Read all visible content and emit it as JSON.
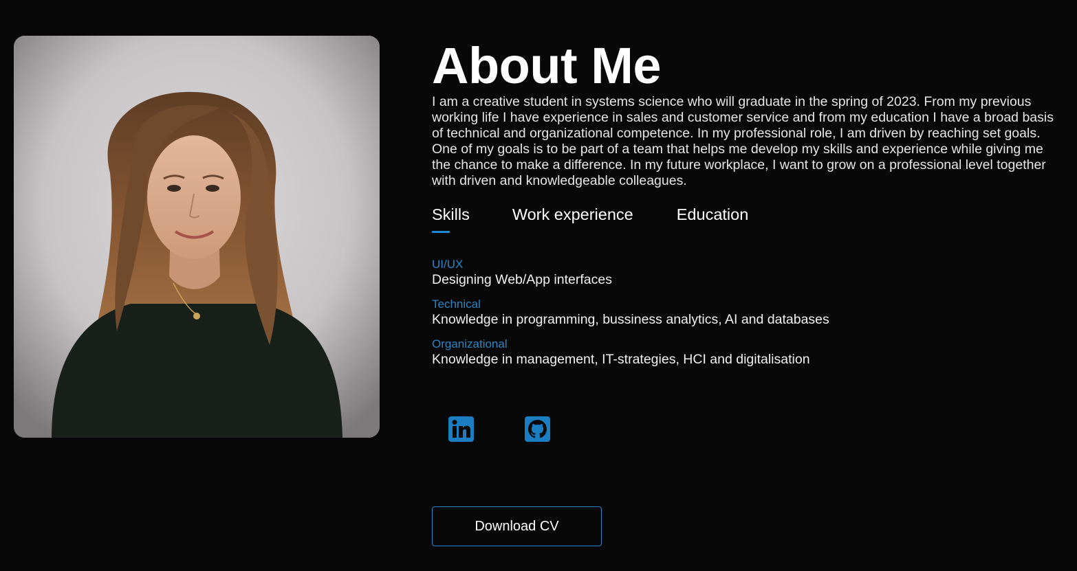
{
  "about": {
    "title": "About Me",
    "intro": "I am a creative student in systems science who will graduate in the spring of 2023. From my previous working life I have experience in sales and customer service and from my education I have a broad basis of technical and organizational competence. In my professional role, I am driven by reaching set goals. One of my goals is to be part of a team that helps me develop my skills and experience while giving me the chance to make a difference. In my future workplace, I want to grow on a professional level together with driven and knowledgeable colleagues."
  },
  "tabs": [
    {
      "label": "Skills",
      "active": true
    },
    {
      "label": "Work experience",
      "active": false
    },
    {
      "label": "Education",
      "active": false
    }
  ],
  "skills": [
    {
      "name": "UI/UX",
      "description": "Designing Web/App interfaces"
    },
    {
      "name": "Technical",
      "description": "Knowledge in programming, bussiness analytics, AI and databases"
    },
    {
      "name": "Organizational",
      "description": "Knowledge in management, IT-strategies, HCI and digitalisation"
    }
  ],
  "social": [
    {
      "icon": "linkedin-icon",
      "color": "#1b7ec2"
    },
    {
      "icon": "github-icon",
      "color": "#1b7ec2"
    }
  ],
  "cv_button": {
    "label": "Download CV"
  },
  "colors": {
    "background": "#080808",
    "accent": "#2b86c4",
    "text": "#ffffff"
  }
}
